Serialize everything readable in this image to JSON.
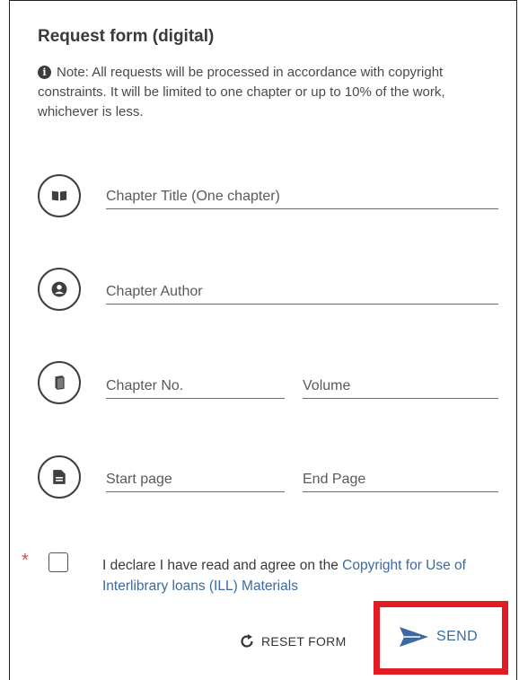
{
  "form": {
    "title": "Request form (digital)",
    "note_icon": "info-icon",
    "note": "Note: All requests will be processed in accordance with copyright constraints. It will be limited to one chapter or up to 10% of the work, whichever is less."
  },
  "fields": {
    "chapter_title": {
      "value": "",
      "placeholder": "Chapter Title (One chapter)",
      "icon": "book-icon"
    },
    "chapter_author": {
      "value": "",
      "placeholder": "Chapter Author",
      "icon": "person-icon"
    },
    "chapter_no": {
      "value": "",
      "placeholder": "Chapter No.",
      "icon": "books-icon"
    },
    "volume": {
      "value": "",
      "placeholder": "Volume"
    },
    "start_page": {
      "value": "",
      "placeholder": "Start page",
      "icon": "document-icon"
    },
    "end_page": {
      "value": "",
      "placeholder": "End Page"
    }
  },
  "declaration": {
    "required_marker": "*",
    "checked": false,
    "text": "I declare I have read and agree on the ",
    "link_text": "Copyright for Use of Interlibrary loans (ILL) Materials"
  },
  "actions": {
    "reset_label": "RESET FORM",
    "reset_icon": "refresh-icon",
    "send_label": "SEND",
    "send_icon": "send-icon"
  },
  "colors": {
    "link": "#3b6aa0",
    "required": "#d94a4a",
    "highlight_frame": "#e01b23"
  }
}
